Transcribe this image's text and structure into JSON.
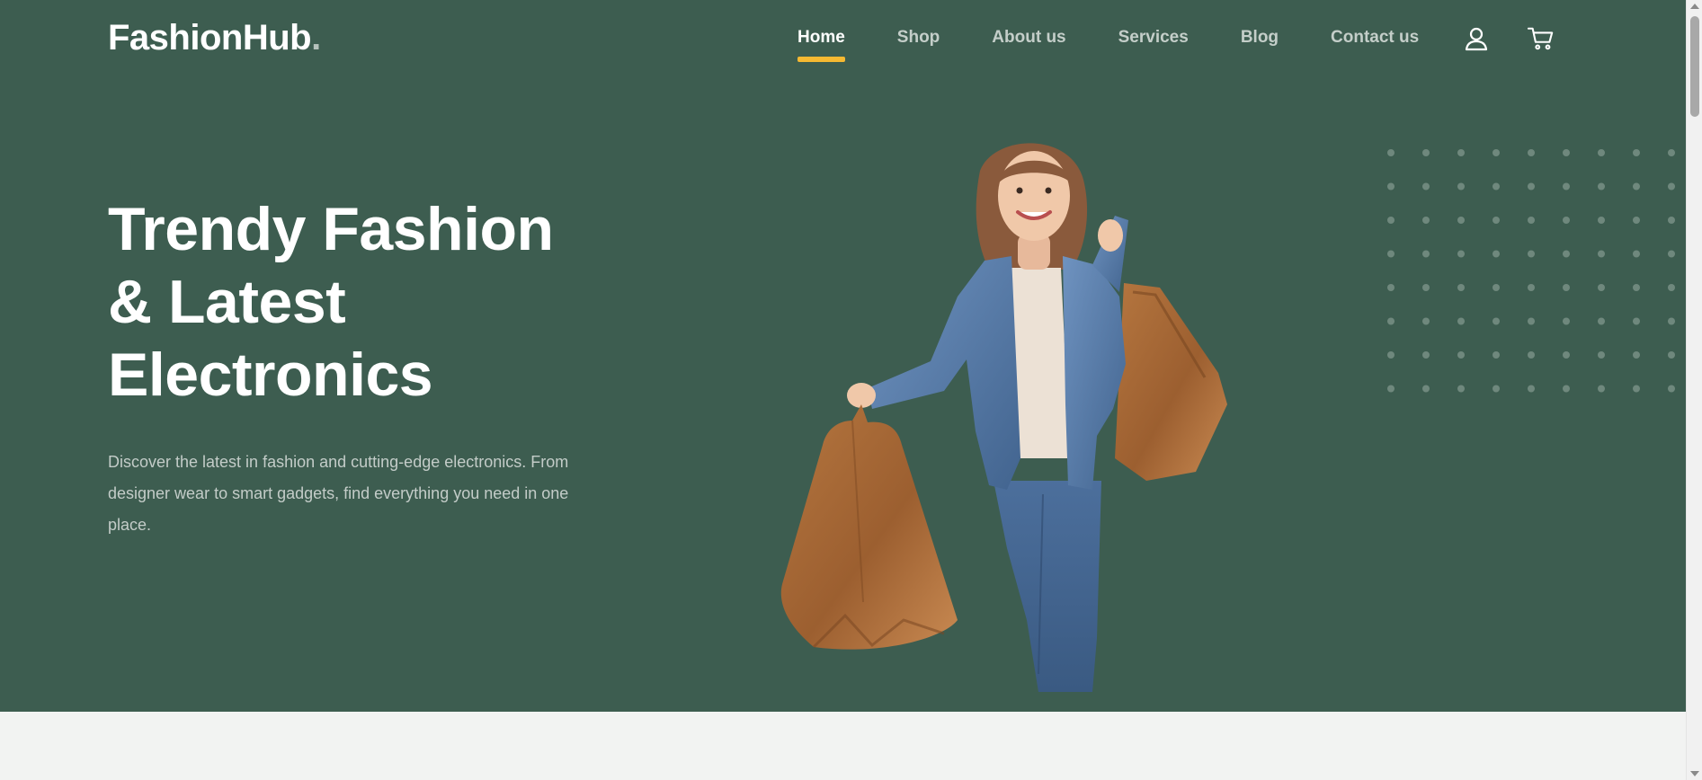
{
  "brand": {
    "name": "FashionHub",
    "dot": "."
  },
  "nav": {
    "items": [
      {
        "label": "Home",
        "active": true
      },
      {
        "label": "Shop",
        "active": false
      },
      {
        "label": "About us",
        "active": false
      },
      {
        "label": "Services",
        "active": false
      },
      {
        "label": "Blog",
        "active": false
      },
      {
        "label": "Contact us",
        "active": false
      }
    ],
    "icons": [
      "user-icon",
      "cart-icon"
    ]
  },
  "hero": {
    "title_lines": [
      "Trendy Fashion",
      "& Latest",
      "Electronics"
    ],
    "description": "Discover the latest in fashion and cutting-edge electronics. From designer wear to smart gadgets, find everything you need in one place.",
    "image": "woman-with-shopping-bags"
  },
  "colors": {
    "hero_bg": "#3d5d50",
    "accent": "#f6b932",
    "nav_text": "#c4cec9",
    "nav_active": "#ffffff",
    "page_bg": "#f2f3f2"
  }
}
